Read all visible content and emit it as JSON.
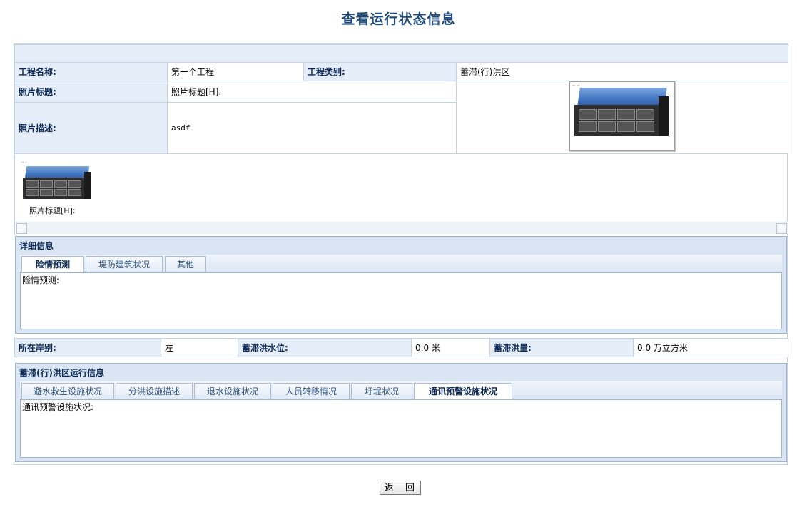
{
  "page_title": "查看运行状态信息",
  "info": {
    "project_name_label": "工程名称:",
    "project_name": "第一个工程",
    "project_type_label": "工程类别:",
    "project_type": "蓄滞(行)洪区",
    "photo_title_label": "照片标题:",
    "photo_title": "照片标题[H]:",
    "photo_desc_label": "照片描述:",
    "photo_desc": "asdf"
  },
  "thumbnail": {
    "caption": "照片标题[H]:"
  },
  "detail_panel": {
    "title": "详细信息",
    "tabs": [
      "险情预测",
      "堤防建筑状况",
      "其他"
    ],
    "active_tab": 0,
    "content": "险情预测:"
  },
  "side_row": {
    "bank_label": "所在岸别:",
    "bank": "左",
    "water_level_label": "蓄滞洪水位:",
    "water_level": "0.0 米",
    "volume_label": "蓄滞洪量:",
    "volume": "0.0 万立方米"
  },
  "operation_panel": {
    "title": "蓄滞(行)洪区运行信息",
    "tabs": [
      "避水救生设施状况",
      "分洪设施描述",
      "退水设施状况",
      "人员转移情况",
      "圩堤状况",
      "通讯预警设施状况"
    ],
    "active_tab": 5,
    "content": "通讯预警设施状况:"
  },
  "back_button": "返 回",
  "colors": {
    "title": "#1e4a7a",
    "label_bg": "#e5edf8",
    "border": "#c5d3e2",
    "panel_bg": "#d9e5f2"
  }
}
